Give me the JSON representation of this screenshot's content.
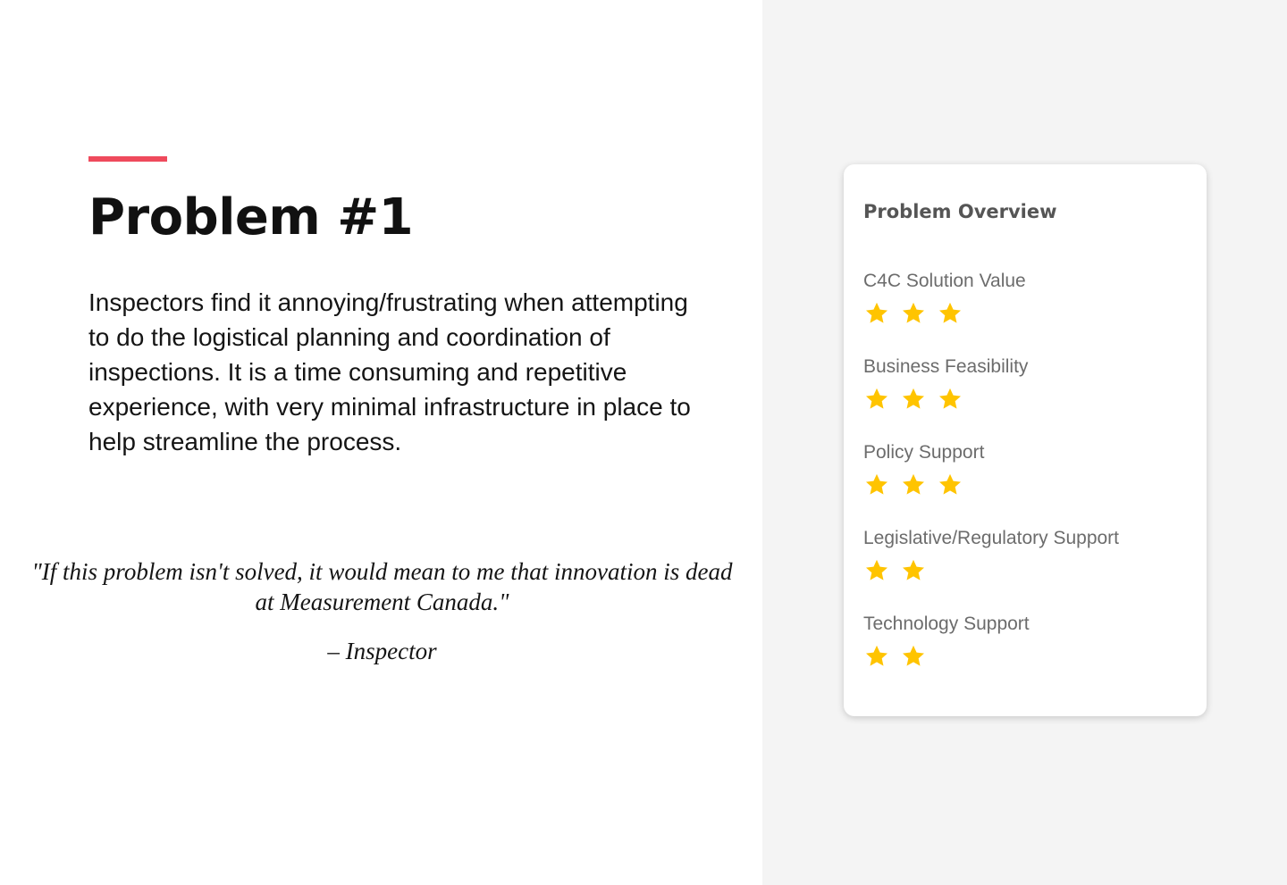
{
  "problem": {
    "title": "Problem #1",
    "description": "Inspectors find it annoying/frustrating when attempting to do the logistical planning and coordination of inspections. It is a time consuming and repetitive experience, with very minimal infrastructure in place to help streamline the process.",
    "quote": "\"If this problem isn't solved, it would mean to me that innovation is dead at Measurement Canada.\"",
    "attribution": "– Inspector"
  },
  "overview": {
    "title": "Problem Overview",
    "criteria": [
      {
        "label": "C4C Solution Value",
        "rating": 3
      },
      {
        "label": "Business Feasibility",
        "rating": 3
      },
      {
        "label": "Policy Support",
        "rating": 3
      },
      {
        "label": "Legislative/Regulatory Support",
        "rating": 2
      },
      {
        "label": "Technology Support",
        "rating": 2
      }
    ]
  },
  "colors": {
    "accent": "#ef4a5c",
    "star": "#ffc400",
    "right_panel_bg": "#f4f4f4"
  },
  "icons": {
    "rating": "star-icon"
  }
}
